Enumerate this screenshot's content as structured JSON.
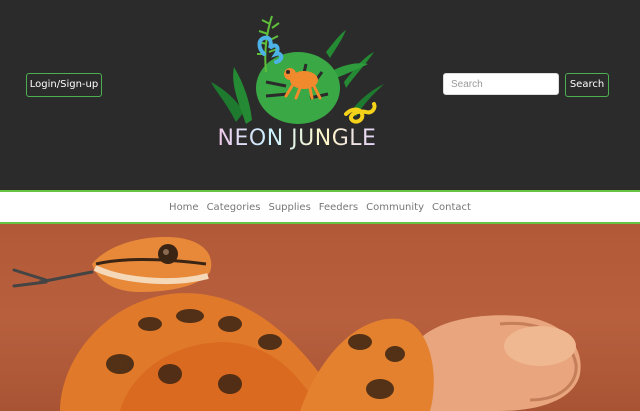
{
  "header": {
    "login_label": "Login/Sign-up",
    "brand_name": "NEON JUNGLE",
    "search": {
      "placeholder": "Search",
      "value": ""
    },
    "search_button_label": "Search"
  },
  "nav": {
    "items": [
      {
        "label": "Home"
      },
      {
        "label": "Categories"
      },
      {
        "label": "Supplies"
      },
      {
        "label": "Feeders"
      },
      {
        "label": "Community"
      },
      {
        "label": "Contact"
      }
    ]
  },
  "colors": {
    "header_bg": "#2b2b2b",
    "accent_green": "#67c443",
    "nav_bg": "#ffffff",
    "hero_bg": "#b25a38"
  },
  "hero": {
    "image": "snake-photo"
  }
}
